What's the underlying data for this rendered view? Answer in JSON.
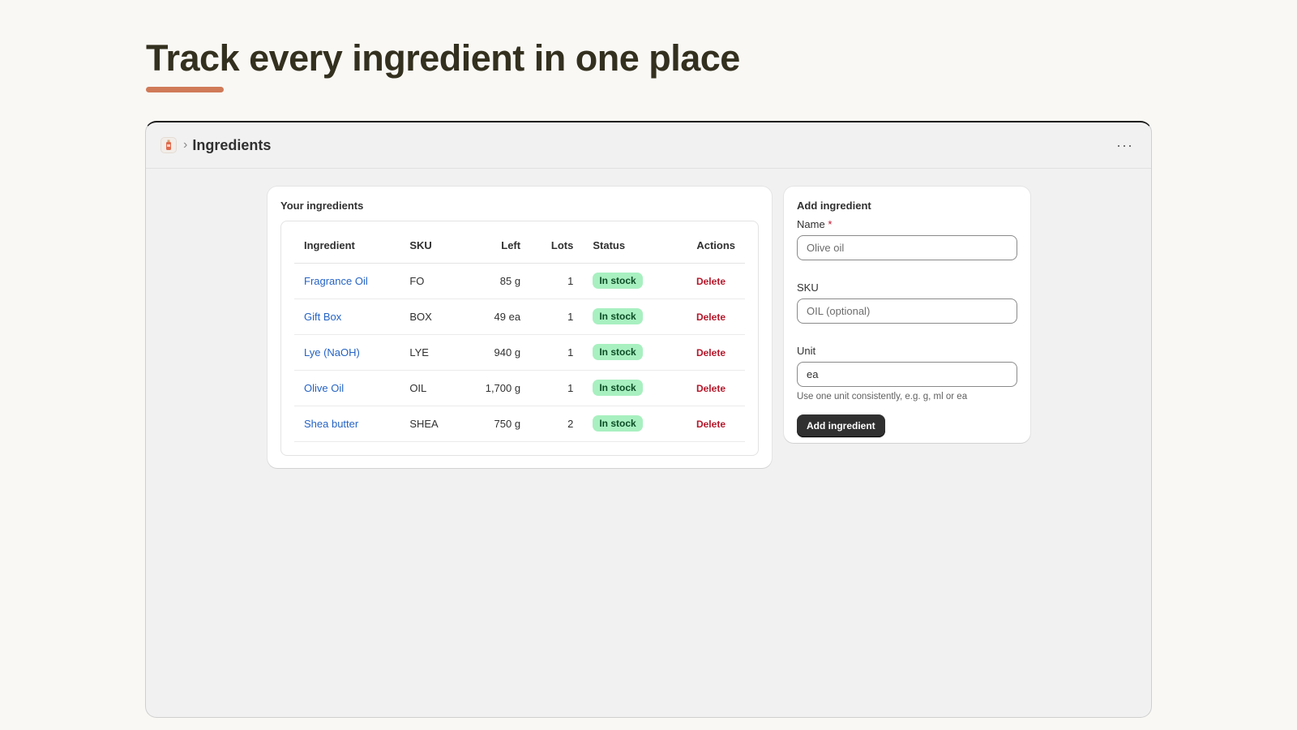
{
  "headline": "Track every ingredient in one place",
  "accent_color": "#d07a58",
  "window": {
    "title": "Ingredients",
    "crumb_separator": "›",
    "app_icon": "bottle-icon",
    "more_label": "···"
  },
  "list": {
    "title": "Your ingredients",
    "columns": [
      "Ingredient",
      "SKU",
      "Left",
      "Lots",
      "Status",
      "Actions"
    ],
    "rows": [
      {
        "name": "Fragrance Oil",
        "sku": "FO",
        "left": "85 g",
        "lots": "1",
        "status": "In stock",
        "action": "Delete"
      },
      {
        "name": "Gift Box",
        "sku": "BOX",
        "left": "49 ea",
        "lots": "1",
        "status": "In stock",
        "action": "Delete"
      },
      {
        "name": "Lye (NaOH)",
        "sku": "LYE",
        "left": "940 g",
        "lots": "1",
        "status": "In stock",
        "action": "Delete"
      },
      {
        "name": "Olive Oil",
        "sku": "OIL",
        "left": "1,700 g",
        "lots": "1",
        "status": "In stock",
        "action": "Delete"
      },
      {
        "name": "Shea butter",
        "sku": "SHEA",
        "left": "750 g",
        "lots": "2",
        "status": "In stock",
        "action": "Delete"
      }
    ]
  },
  "form": {
    "title": "Add ingredient",
    "name_label": "Name",
    "required_mark": "*",
    "name_placeholder": "Olive oil",
    "sku_label": "SKU",
    "sku_placeholder": "OIL (optional)",
    "unit_label": "Unit",
    "unit_value": "ea",
    "unit_help": "Use one unit consistently, e.g. g, ml or ea",
    "submit_label": "Add ingredient"
  }
}
